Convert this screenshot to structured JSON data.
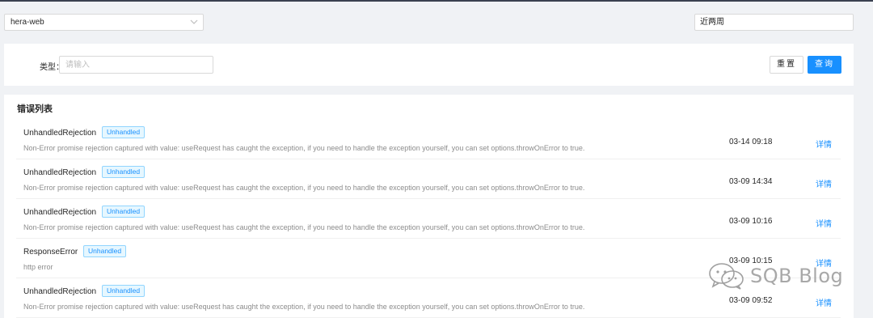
{
  "header": {
    "app_select": "hera-web",
    "date_range": "近两周"
  },
  "filter": {
    "type_label": "类型：",
    "type_placeholder": "请输入",
    "reset_label": "重置",
    "query_label": "查询"
  },
  "list": {
    "title": "错误列表",
    "rows": [
      {
        "name": "UnhandledRejection",
        "badge": "Unhandled",
        "message": "Non-Error promise rejection captured with value: useRequest has caught the exception, if you need to handle the exception yourself, you can set options.throwOnError to true.",
        "time": "03-14 09:18",
        "action": "详情"
      },
      {
        "name": "UnhandledRejection",
        "badge": "Unhandled",
        "message": "Non-Error promise rejection captured with value: useRequest has caught the exception, if you need to handle the exception yourself, you can set options.throwOnError to true.",
        "time": "03-09 14:34",
        "action": "详情"
      },
      {
        "name": "UnhandledRejection",
        "badge": "Unhandled",
        "message": "Non-Error promise rejection captured with value: useRequest has caught the exception, if you need to handle the exception yourself, you can set options.throwOnError to true.",
        "time": "03-09 10:16",
        "action": "详情"
      },
      {
        "name": "ResponseError",
        "badge": "Unhandled",
        "message": "http error",
        "time": "03-09 10:15",
        "action": "详情"
      },
      {
        "name": "UnhandledRejection",
        "badge": "Unhandled",
        "message": "Non-Error promise rejection captured with value: useRequest has caught the exception, if you need to handle the exception yourself, you can set options.throwOnError to true.",
        "time": "03-09 09:52",
        "action": "详情"
      }
    ]
  },
  "watermark": {
    "text": "SQB Blog",
    "icon": "wechat-icon"
  },
  "colors": {
    "accent": "#1890ff",
    "badge_bg": "#e6f7ff",
    "badge_border": "#91d5ff",
    "page_bg": "#f0f2f5"
  }
}
